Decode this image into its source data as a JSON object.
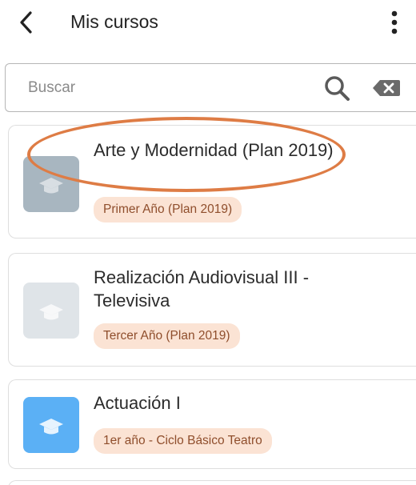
{
  "header": {
    "title": "Mis cursos"
  },
  "search": {
    "placeholder": "Buscar",
    "value": ""
  },
  "courses": [
    {
      "name": "Arte y Modernidad (Plan 2019)",
      "badge": "Primer Año (Plan 2019)",
      "image_color": "#a8b6c0"
    },
    {
      "name": "Realización Audiovisual III - Televisiva",
      "badge": "Tercer Año (Plan 2019)",
      "image_color": "#dfe4e8"
    },
    {
      "name": "Actuación I",
      "badge": "1er año - Ciclo Básico Teatro",
      "image_color": "#5bb0f5"
    }
  ],
  "colors": {
    "annotation": "#de7c45",
    "badge_bg": "#fbe3d4",
    "badge_text": "#8f4e2c"
  },
  "icons": [
    "back-arrow-icon",
    "more-vertical-icon",
    "search-icon",
    "clear-icon",
    "graduation-cap-icon"
  ]
}
